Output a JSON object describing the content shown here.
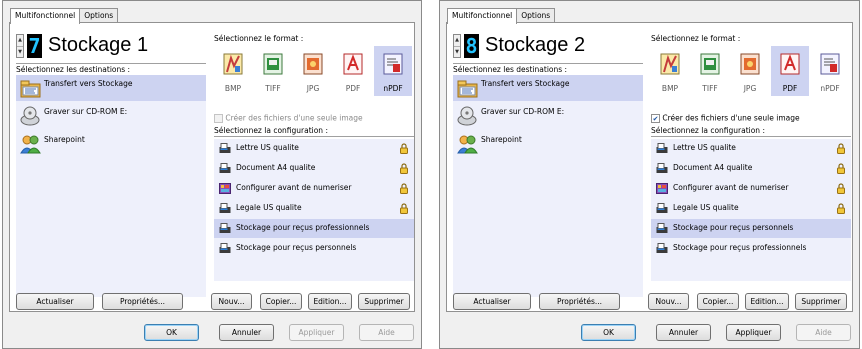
{
  "panels": [
    {
      "tabs": [
        {
          "label": "Multifonctionnel",
          "active": true
        },
        {
          "label": "Options",
          "active": false
        }
      ],
      "profile": {
        "number": "7",
        "name": "Stockage 1"
      },
      "destinations_label": "Sélectionnez les destinations :",
      "destinations": [
        {
          "label": "Transfert vers Stockage",
          "icon": "folder-transfer-icon",
          "selected": true
        },
        {
          "label": "Graver sur CD-ROM  E:",
          "icon": "cd-burner-icon",
          "selected": false
        },
        {
          "label": "Sharepoint",
          "icon": "sharepoint-icon",
          "selected": false
        }
      ],
      "format_label": "Sélectionnez le format :",
      "formats": [
        {
          "label": "BMP",
          "icon": "bmp-format-icon",
          "selected": false
        },
        {
          "label": "TIFF",
          "icon": "tiff-format-icon",
          "selected": false
        },
        {
          "label": "JPG",
          "icon": "jpg-format-icon",
          "selected": false
        },
        {
          "label": "PDF",
          "icon": "pdf-format-icon",
          "selected": false
        },
        {
          "label": "nPDF",
          "icon": "npdf-format-icon",
          "selected": true
        }
      ],
      "single_image": {
        "label": "Créer des fichiers d'une seule image",
        "checked": false,
        "enabled": false
      },
      "config_label": "Sélectionnez la configuration :",
      "configs": [
        {
          "label": "Lettre US qualite",
          "icon": "scanner-icon",
          "locked": true,
          "selected": false
        },
        {
          "label": "Document A4 qualite",
          "icon": "scanner-icon",
          "locked": true,
          "selected": false
        },
        {
          "label": "Configurer avant de numeriser",
          "icon": "configure-icon",
          "locked": true,
          "selected": false
        },
        {
          "label": "Legale US qualite",
          "icon": "scanner-icon",
          "locked": true,
          "selected": false
        },
        {
          "label": "Stockage pour reçus professionnels",
          "icon": "scanner-icon",
          "locked": false,
          "selected": true
        },
        {
          "label": "Stockage pour reçus personnels",
          "icon": "scanner-icon",
          "locked": false,
          "selected": false
        }
      ],
      "buttons": {
        "refresh": "Actualiser",
        "properties": "Propriétés...",
        "new": "Nouv...",
        "copy": "Copier...",
        "edit": "Edition...",
        "delete": "Supprimer",
        "ok": "OK",
        "cancel": "Annuler",
        "apply": "Appliquer",
        "help": "Aide",
        "apply_enabled": false
      }
    },
    {
      "tabs": [
        {
          "label": "Multifonctionnel",
          "active": true
        },
        {
          "label": "Options",
          "active": false
        }
      ],
      "profile": {
        "number": "8",
        "name": "Stockage 2"
      },
      "destinations_label": "Sélectionnez les destinations :",
      "destinations": [
        {
          "label": "Transfert vers Stockage",
          "icon": "folder-transfer-icon",
          "selected": true
        },
        {
          "label": "Graver sur CD-ROM  E:",
          "icon": "cd-burner-icon",
          "selected": false
        },
        {
          "label": "Sharepoint",
          "icon": "sharepoint-icon",
          "selected": false
        }
      ],
      "format_label": "Sélectionnez le format :",
      "formats": [
        {
          "label": "BMP",
          "icon": "bmp-format-icon",
          "selected": false
        },
        {
          "label": "TIFF",
          "icon": "tiff-format-icon",
          "selected": false
        },
        {
          "label": "JPG",
          "icon": "jpg-format-icon",
          "selected": false
        },
        {
          "label": "PDF",
          "icon": "pdf-format-icon",
          "selected": true
        },
        {
          "label": "nPDF",
          "icon": "npdf-format-icon",
          "selected": false
        }
      ],
      "single_image": {
        "label": "Créer des fichiers d'une seule image",
        "checked": true,
        "enabled": true
      },
      "config_label": "Sélectionnez la configuration :",
      "configs": [
        {
          "label": "Lettre US qualite",
          "icon": "scanner-icon",
          "locked": true,
          "selected": false
        },
        {
          "label": "Document A4 qualite",
          "icon": "scanner-icon",
          "locked": true,
          "selected": false
        },
        {
          "label": "Configurer avant de numeriser",
          "icon": "configure-icon",
          "locked": true,
          "selected": false
        },
        {
          "label": "Legale US qualite",
          "icon": "scanner-icon",
          "locked": true,
          "selected": false
        },
        {
          "label": "Stockage pour reçus personnels",
          "icon": "scanner-icon",
          "locked": false,
          "selected": true
        },
        {
          "label": "Stockage pour reçus professionnels",
          "icon": "scanner-icon",
          "locked": false,
          "selected": false
        }
      ],
      "buttons": {
        "refresh": "Actualiser",
        "properties": "Propriétés...",
        "new": "Nouv...",
        "copy": "Copier...",
        "edit": "Edition...",
        "delete": "Supprimer",
        "ok": "OK",
        "cancel": "Annuler",
        "apply": "Appliquer",
        "help": "Aide",
        "apply_enabled": true
      }
    }
  ],
  "colors": {
    "selection": "#cdd3f1",
    "list_background": "#eef0fb",
    "digit": "#23c3ff"
  }
}
